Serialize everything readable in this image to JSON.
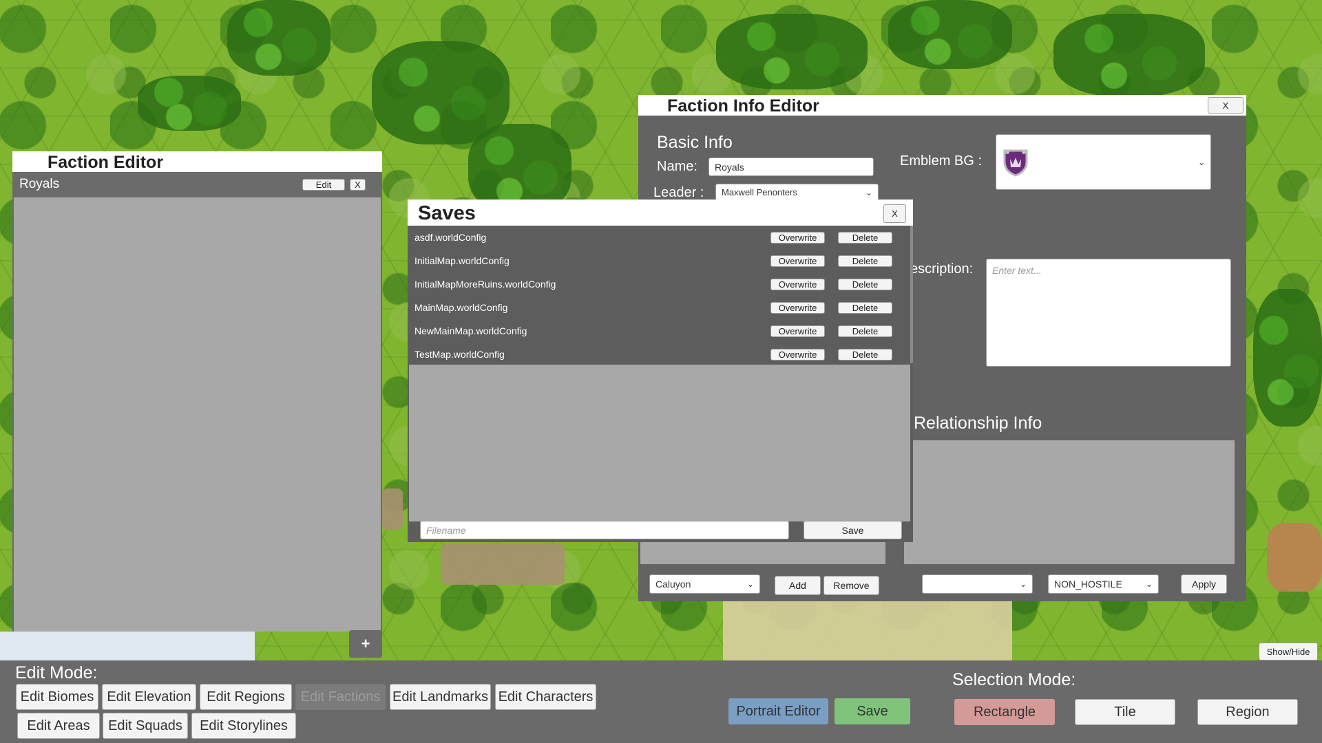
{
  "faction_editor": {
    "title": "Faction Editor",
    "selected_faction": "Royals",
    "edit_label": "Edit",
    "close_label": "X",
    "add_label": "+"
  },
  "saves": {
    "title": "Saves",
    "close_label": "X",
    "overwrite_label": "Overwrite",
    "delete_label": "Delete",
    "files": [
      "asdf.worldConfig",
      "InitialMap.worldConfig",
      "InitialMapMoreRuins.worldConfig",
      "MainMap.worldConfig",
      "NewMainMap.worldConfig",
      "TestMap.worldConfig"
    ],
    "filename_placeholder": "Filename",
    "save_label": "Save"
  },
  "faction_info": {
    "title": "Faction Info Editor",
    "close_label": "X",
    "basic_info_heading": "Basic Info",
    "name_label": "Name:",
    "name_value": "Royals",
    "leader_label": "Leader :",
    "leader_value": "Maxwell Penonters",
    "emblem_label": "Emblem BG :",
    "description_label": "escription:",
    "description_placeholder": "Enter text...",
    "relationship_heading": "Relationship Info",
    "member_select_value": "Caluyon",
    "add_label": "Add",
    "remove_label": "Remove",
    "relation_target_value": "",
    "relation_type_value": "NON_HOSTILE",
    "apply_label": "Apply"
  },
  "show_hide_label": "Show/Hide",
  "toolbar": {
    "edit_mode_label": "Edit Mode:",
    "edit_buttons": [
      "Edit Biomes",
      "Edit Elevation",
      "Edit Regions",
      "Edit Factions",
      "Edit Landmarks",
      "Edit Characters",
      "Edit Areas",
      "Edit Squads",
      "Edit Storylines"
    ],
    "portrait_editor_label": "Portrait Editor",
    "save_label": "Save",
    "selection_mode_label": "Selection Mode:",
    "selection_buttons": [
      "Rectangle",
      "Tile",
      "Region"
    ]
  },
  "colors": {
    "portrait_editor": "#7a9ec4",
    "save_green": "#7fc47a",
    "rectangle_selected": "#d49a98"
  }
}
